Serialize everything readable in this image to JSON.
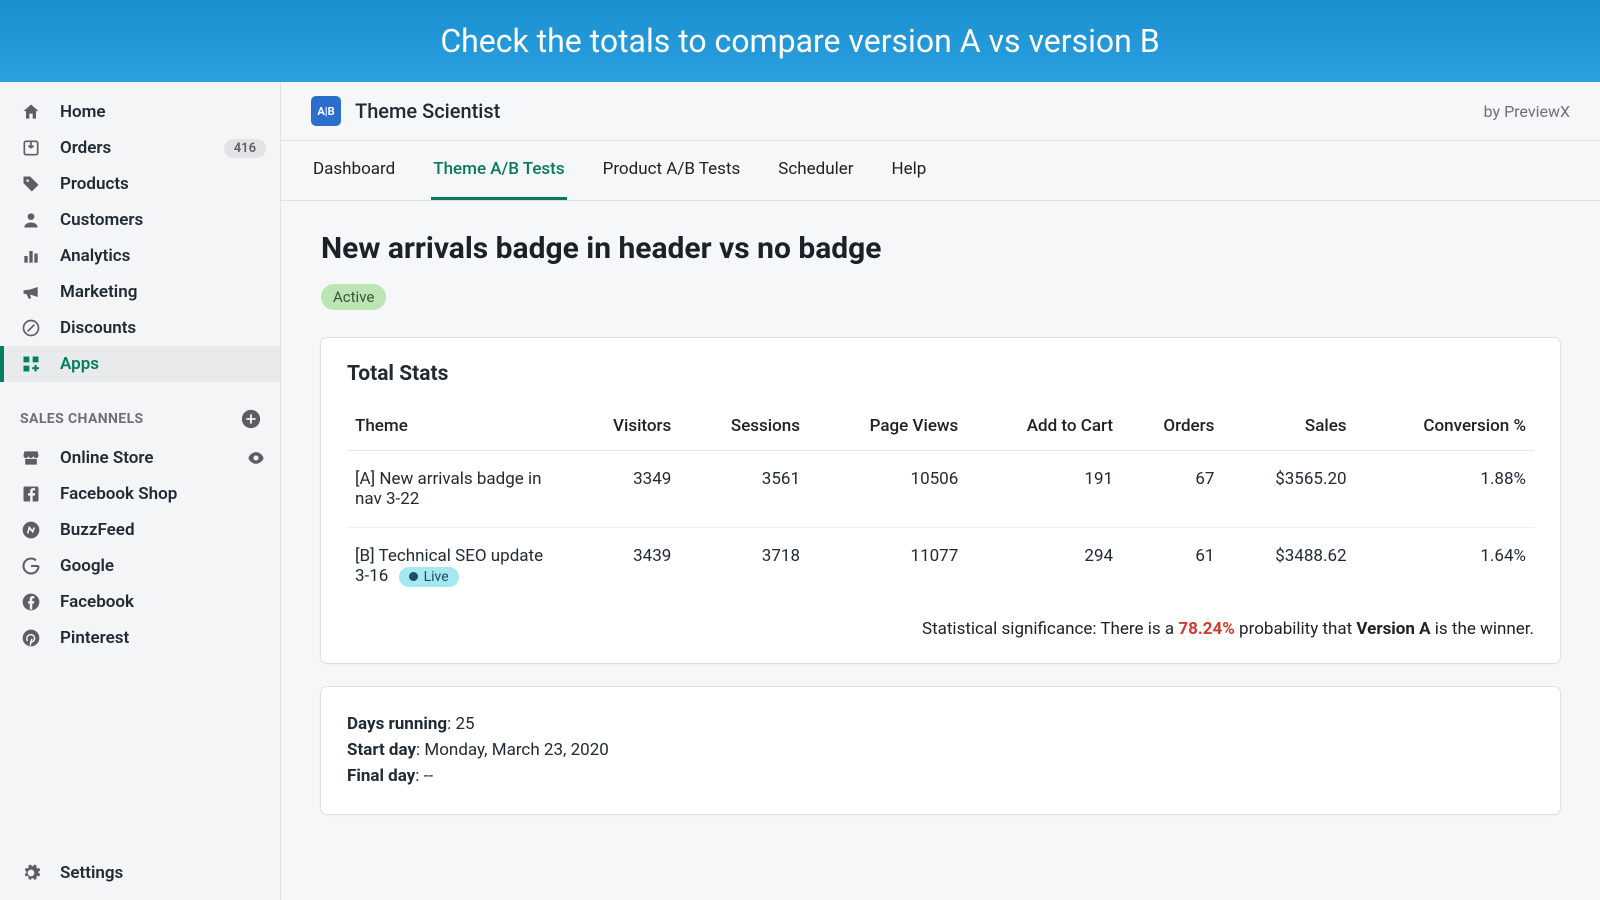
{
  "banner": "Check the totals to compare version A vs version B",
  "sidebar": {
    "items": [
      {
        "label": "Home"
      },
      {
        "label": "Orders",
        "badge": "416"
      },
      {
        "label": "Products"
      },
      {
        "label": "Customers"
      },
      {
        "label": "Analytics"
      },
      {
        "label": "Marketing"
      },
      {
        "label": "Discounts"
      },
      {
        "label": "Apps"
      }
    ],
    "section_header": "SALES CHANNELS",
    "channels": [
      {
        "label": "Online Store",
        "eye": true
      },
      {
        "label": "Facebook Shop"
      },
      {
        "label": "BuzzFeed"
      },
      {
        "label": "Google"
      },
      {
        "label": "Facebook"
      },
      {
        "label": "Pinterest"
      }
    ],
    "settings": "Settings"
  },
  "app": {
    "name": "Theme Scientist",
    "logo_text": "A|B",
    "byline": "by PreviewX"
  },
  "tabs": [
    "Dashboard",
    "Theme A/B Tests",
    "Product A/B Tests",
    "Scheduler",
    "Help"
  ],
  "page": {
    "title": "New arrivals badge in header vs no badge",
    "status": "Active"
  },
  "stats": {
    "heading": "Total Stats",
    "columns": [
      "Theme",
      "Visitors",
      "Sessions",
      "Page Views",
      "Add to Cart",
      "Orders",
      "Sales",
      "Conversion %"
    ],
    "rows": [
      {
        "theme": "[A] New arrivals badge in nav 3-22",
        "live": false,
        "visitors": "3349",
        "sessions": "3561",
        "page_views": "10506",
        "add_to_cart": "191",
        "orders": "67",
        "sales": "$3565.20",
        "conversion": "1.88%"
      },
      {
        "theme": "[B] Technical SEO update 3-16",
        "live": true,
        "live_label": "Live",
        "visitors": "3439",
        "sessions": "3718",
        "page_views": "11077",
        "add_to_cart": "294",
        "orders": "61",
        "sales": "$3488.62",
        "conversion": "1.64%"
      }
    ],
    "stat_sig_prefix": "Statistical significance: There is a ",
    "stat_sig_pct": "78.24%",
    "stat_sig_mid": " probability that ",
    "stat_sig_version": "Version A",
    "stat_sig_suffix": " is the winner."
  },
  "meta": {
    "days_running_label": "Days running",
    "days_running_value": "25",
    "start_day_label": "Start day",
    "start_day_value": "Monday, March 23, 2020",
    "final_day_label": "Final day",
    "final_day_value": "--"
  }
}
